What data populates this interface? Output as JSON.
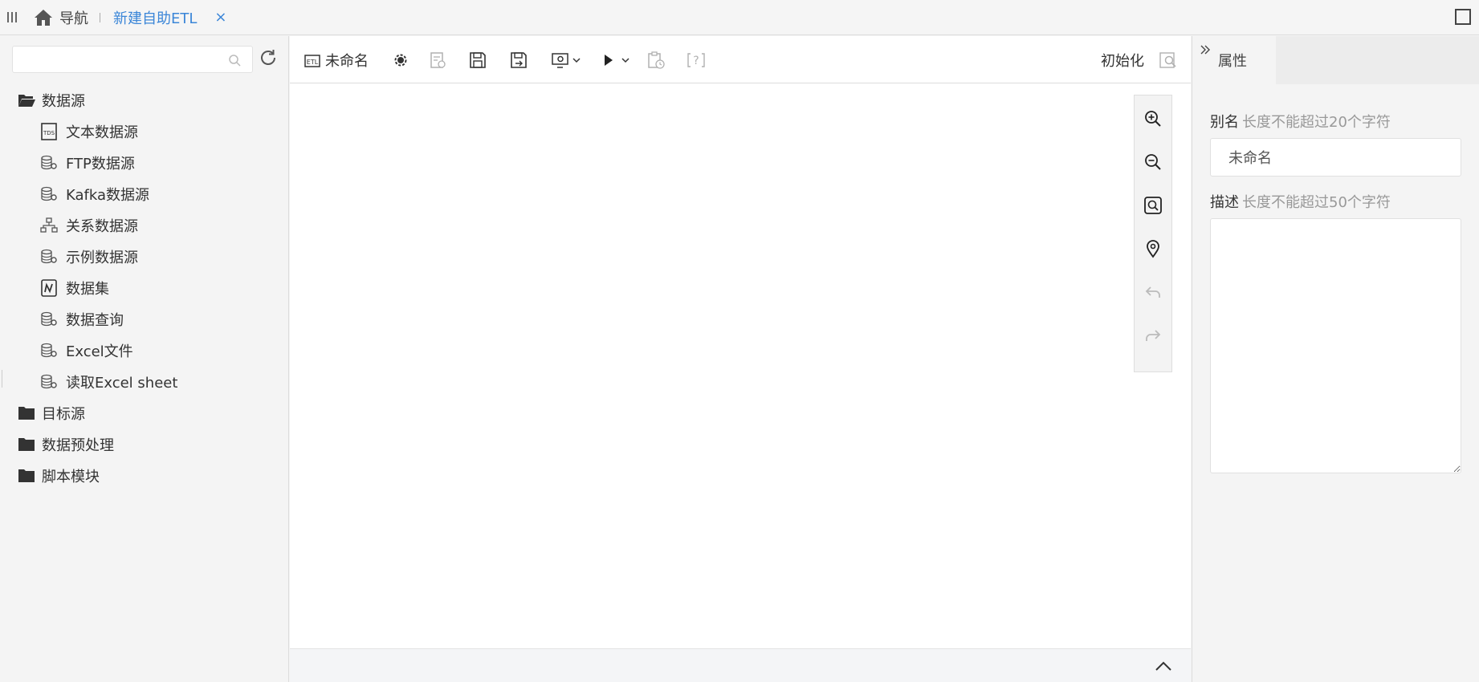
{
  "topbar": {
    "nav_label": "导航",
    "active_tab": "新建自助ETL",
    "close_glyph": "×"
  },
  "left": {
    "search": {
      "value": "",
      "placeholder": ""
    },
    "tree": {
      "datasource": {
        "label": "数据源",
        "children": [
          {
            "label": "文本数据源",
            "icon": "text-datasource-icon"
          },
          {
            "label": "FTP数据源",
            "icon": "database-gear-icon"
          },
          {
            "label": "Kafka数据源",
            "icon": "database-gear-icon"
          },
          {
            "label": "关系数据源",
            "icon": "relational-icon"
          },
          {
            "label": "示例数据源",
            "icon": "database-gear-icon"
          },
          {
            "label": "数据集",
            "icon": "dataset-icon"
          },
          {
            "label": "数据查询",
            "icon": "database-gear-icon"
          },
          {
            "label": "Excel文件",
            "icon": "database-gear-icon"
          },
          {
            "label": "读取Excel sheet",
            "icon": "database-gear-icon"
          }
        ]
      },
      "target": {
        "label": "目标源"
      },
      "preprocess": {
        "label": "数据预处理"
      },
      "script": {
        "label": "脚本模块"
      }
    }
  },
  "toolbar": {
    "name_label": "未命名",
    "init_label": "初始化"
  },
  "properties": {
    "tab_label": "属性",
    "alias_label": "别名",
    "alias_hint": "长度不能超过20个字符",
    "alias_value": "未命名",
    "desc_label": "描述",
    "desc_hint": "长度不能超过50个字符",
    "desc_value": ""
  },
  "colors": {
    "accent": "#3b86d8",
    "panel_bg": "#f4f4f4",
    "icon": "#333333",
    "icon_disabled": "#b0b0b0"
  }
}
